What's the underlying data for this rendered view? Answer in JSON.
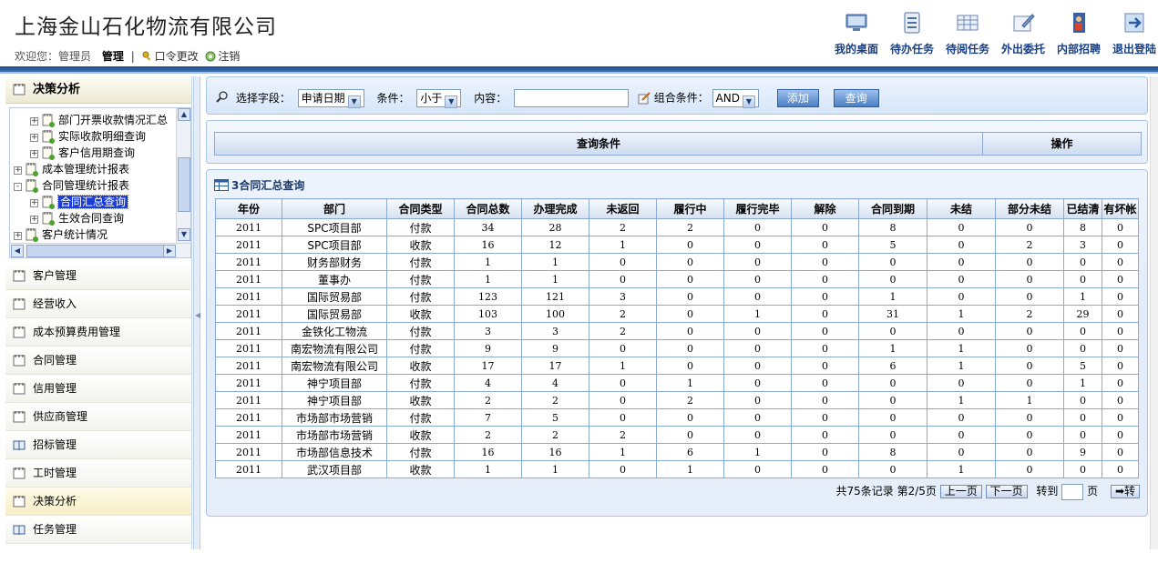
{
  "header": {
    "company_title": "上海金山石化物流有限公司",
    "welcome_prefix": "欢迎您：管理员",
    "role": "管理",
    "change_password": "口令更改",
    "logout": "注销",
    "links": [
      {
        "label": "我的桌面",
        "icon": "desktop-icon"
      },
      {
        "label": "待办任务",
        "icon": "todo-task-icon"
      },
      {
        "label": "待阅任务",
        "icon": "to-read-task-icon"
      },
      {
        "label": "外出委托",
        "icon": "outing-delegate-icon"
      },
      {
        "label": "内部招聘",
        "icon": "recruitment-icon"
      },
      {
        "label": "退出登陆",
        "icon": "exit-icon"
      }
    ]
  },
  "sidebar": {
    "section_title": "决策分析",
    "tree": [
      {
        "label": "部门开票收款情况汇总",
        "level": 2,
        "toggle": "+"
      },
      {
        "label": "实际收款明细查询",
        "level": 2,
        "toggle": "+"
      },
      {
        "label": "客户信用期查询",
        "level": 2,
        "toggle": "+"
      },
      {
        "label": "成本管理统计报表",
        "level": 1,
        "toggle": "+"
      },
      {
        "label": "合同管理统计报表",
        "level": 1,
        "toggle": "-"
      },
      {
        "label": "合同汇总查询",
        "level": 2,
        "toggle": "+",
        "selected": true
      },
      {
        "label": "生效合同查询",
        "level": 2,
        "toggle": "+"
      },
      {
        "label": "客户统计情况",
        "level": 1,
        "toggle": "+"
      }
    ],
    "menu": [
      {
        "label": "客户管理"
      },
      {
        "label": "经营收入"
      },
      {
        "label": "成本预算费用管理"
      },
      {
        "label": "合同管理"
      },
      {
        "label": "信用管理"
      },
      {
        "label": "供应商管理"
      },
      {
        "label": "招标管理"
      },
      {
        "label": "工时管理"
      },
      {
        "label": "决策分析",
        "active": true
      },
      {
        "label": "任务管理"
      }
    ]
  },
  "query": {
    "field_label": "选择字段：",
    "field_value": "申请日期",
    "condition_label": "条件：",
    "condition_value": "小于",
    "content_label": "内容：",
    "content_value": "",
    "combo_label": "组合条件：",
    "combo_value": "AND",
    "add_label": "添加",
    "search_label": "查询"
  },
  "conditions": {
    "col_condition": "查询条件",
    "col_action": "操作"
  },
  "result": {
    "title": "3合同汇总查询",
    "columns": [
      "年份",
      "部门",
      "合同类型",
      "合同总数",
      "办理完成",
      "未返回",
      "履行中",
      "履行完毕",
      "解除",
      "合同到期",
      "未结",
      "部分未结",
      "已结清",
      "有坏帐"
    ],
    "rows": [
      [
        "2011",
        "SPC项目部",
        "付款",
        "34",
        "28",
        "2",
        "2",
        "0",
        "0",
        "8",
        "0",
        "0",
        "8",
        "0"
      ],
      [
        "2011",
        "SPC项目部",
        "收款",
        "16",
        "12",
        "1",
        "0",
        "0",
        "0",
        "5",
        "0",
        "2",
        "3",
        "0"
      ],
      [
        "2011",
        "财务部财务",
        "付款",
        "1",
        "1",
        "0",
        "0",
        "0",
        "0",
        "0",
        "0",
        "0",
        "0",
        "0"
      ],
      [
        "2011",
        "董事办",
        "付款",
        "1",
        "1",
        "0",
        "0",
        "0",
        "0",
        "0",
        "0",
        "0",
        "0",
        "0"
      ],
      [
        "2011",
        "国际贸易部",
        "付款",
        "123",
        "121",
        "3",
        "0",
        "0",
        "0",
        "1",
        "0",
        "0",
        "1",
        "0"
      ],
      [
        "2011",
        "国际贸易部",
        "收款",
        "103",
        "100",
        "2",
        "0",
        "1",
        "0",
        "31",
        "1",
        "2",
        "29",
        "0"
      ],
      [
        "2011",
        "金铁化工物流",
        "付款",
        "3",
        "3",
        "2",
        "0",
        "0",
        "0",
        "0",
        "0",
        "0",
        "0",
        "0"
      ],
      [
        "2011",
        "南宏物流有限公司",
        "付款",
        "9",
        "9",
        "0",
        "0",
        "0",
        "0",
        "1",
        "1",
        "0",
        "0",
        "0"
      ],
      [
        "2011",
        "南宏物流有限公司",
        "收款",
        "17",
        "17",
        "1",
        "0",
        "0",
        "0",
        "6",
        "1",
        "0",
        "5",
        "0"
      ],
      [
        "2011",
        "神宁项目部",
        "付款",
        "4",
        "4",
        "0",
        "1",
        "0",
        "0",
        "0",
        "0",
        "0",
        "1",
        "0"
      ],
      [
        "2011",
        "神宁项目部",
        "收款",
        "2",
        "2",
        "0",
        "2",
        "0",
        "0",
        "0",
        "1",
        "1",
        "0",
        "0"
      ],
      [
        "2011",
        "市场部市场营销",
        "付款",
        "7",
        "5",
        "0",
        "0",
        "0",
        "0",
        "0",
        "0",
        "0",
        "0",
        "0"
      ],
      [
        "2011",
        "市场部市场营销",
        "收款",
        "2",
        "2",
        "2",
        "0",
        "0",
        "0",
        "0",
        "0",
        "0",
        "0",
        "0"
      ],
      [
        "2011",
        "市场部信息技术",
        "付款",
        "16",
        "16",
        "1",
        "6",
        "1",
        "0",
        "8",
        "0",
        "0",
        "9",
        "0"
      ],
      [
        "2011",
        "武汉项目部",
        "收款",
        "1",
        "1",
        "0",
        "1",
        "0",
        "0",
        "0",
        "1",
        "0",
        "0",
        "0"
      ]
    ]
  },
  "pager": {
    "summary": "共75条记录 第2/5页",
    "prev_label": "上一页",
    "next_label": "下一页",
    "goto_prefix": "转到",
    "goto_suffix": "页",
    "go_label": "➡转",
    "goto_value": ""
  },
  "colors": {
    "header_bar": "#1b4a8f",
    "link_text": "#1a3f80",
    "selected_tree": "#1b3dd8",
    "panel_border": "#a9c4e8",
    "button_blue": "#4b7fc4"
  }
}
